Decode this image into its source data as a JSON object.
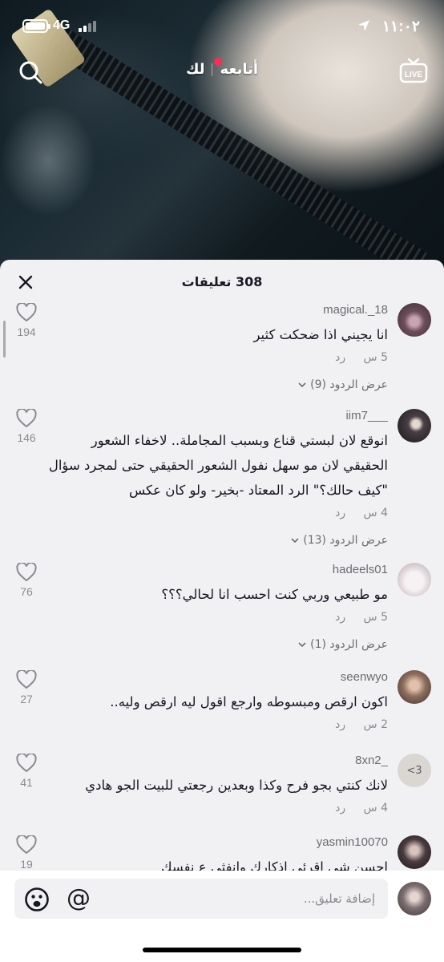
{
  "status_bar": {
    "time": "١١:٠٢",
    "network": "4G"
  },
  "nav": {
    "tab_following": "أتابعه",
    "tab_for_you": "لك",
    "live_label": "LIVE"
  },
  "sheet": {
    "title": "308 تعليقات"
  },
  "comments": [
    {
      "user": "magical._18",
      "text": "انا يجيني اذا ضحكت كثير",
      "time": "5 س",
      "reply": "رد",
      "likes": "194",
      "replies": "عرض الردود (9)",
      "avatar_color": "#7b5a6a"
    },
    {
      "user": "iim7___",
      "text": "انوقع لان لبستي قناع وبسبب المجاملة.. لاخفاء الشعور الحقيقي لان مو سهل نفول الشعور الحقيقي حتى لمجرد سؤال \"كيف حالك؟\" الرد المعتاد -بخير- ولو كان عكس",
      "time": "4 س",
      "reply": "رد",
      "likes": "146",
      "replies": "عرض الردود (13)",
      "avatar_color": "#2b2a30"
    },
    {
      "user": "hadeels01",
      "text": "مو طبيعي وربي كنت احسب انا لحالي؟؟؟",
      "time": "5 س",
      "reply": "رد",
      "likes": "76",
      "replies": "عرض الردود (1)",
      "avatar_color": "#ede8ea"
    },
    {
      "user": "seenwyo",
      "text": "اكون ارقص ومبسوطه وارجع اقول ليه ارقص وليه..",
      "time": "2 س",
      "reply": "رد",
      "likes": "27",
      "replies": "",
      "avatar_color": "#8d6e5c"
    },
    {
      "user": "8xn2_",
      "text": "لانك كنتي بجو فرح وكذا وبعدين رجعتي للبيت الجو هادي",
      "time": "4 س",
      "reply": "رد",
      "likes": "41",
      "replies": "",
      "avatar_color": "#dad7d3"
    },
    {
      "user": "yasmin10070",
      "text": "احسن شي اقرئي اذكارك وانفثي ع نفسك",
      "time": "",
      "reply": "",
      "likes": "19",
      "replies": "",
      "avatar_color": "#2a2326"
    }
  ],
  "input": {
    "placeholder": "إضافة تعليق..."
  },
  "colors": {
    "accent": "#fe2c55",
    "sheet_bg": "#f1f1f3",
    "text_primary": "#161823",
    "text_secondary": "#8a8b91"
  }
}
